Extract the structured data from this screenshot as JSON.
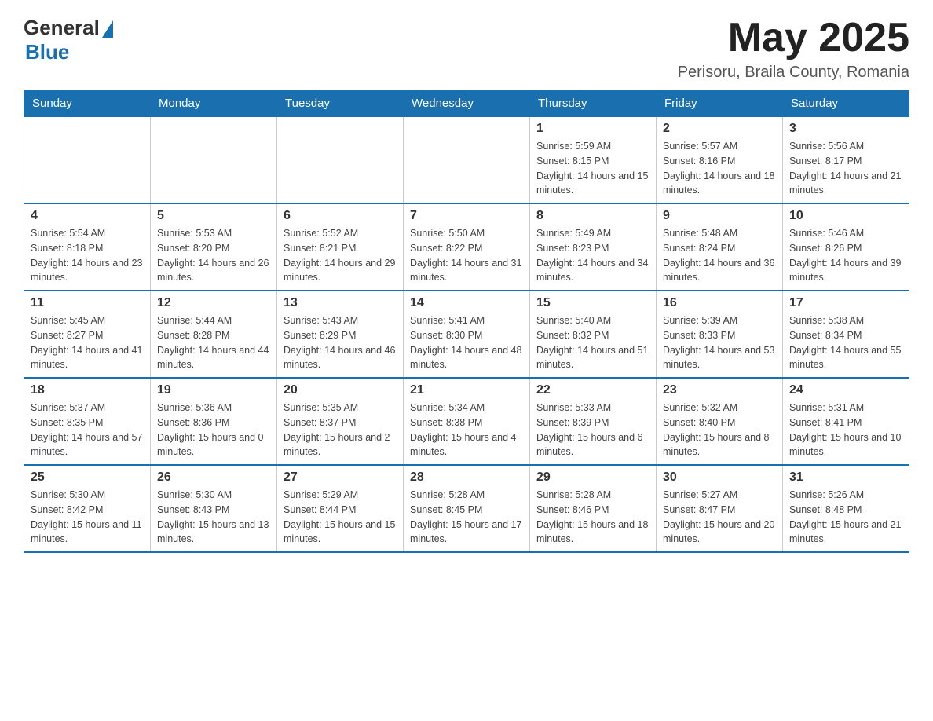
{
  "header": {
    "logo_general": "General",
    "logo_blue": "Blue",
    "month_year": "May 2025",
    "location": "Perisoru, Braila County, Romania"
  },
  "weekdays": [
    "Sunday",
    "Monday",
    "Tuesday",
    "Wednesday",
    "Thursday",
    "Friday",
    "Saturday"
  ],
  "weeks": [
    [
      {
        "day": "",
        "sunrise": "",
        "sunset": "",
        "daylight": ""
      },
      {
        "day": "",
        "sunrise": "",
        "sunset": "",
        "daylight": ""
      },
      {
        "day": "",
        "sunrise": "",
        "sunset": "",
        "daylight": ""
      },
      {
        "day": "",
        "sunrise": "",
        "sunset": "",
        "daylight": ""
      },
      {
        "day": "1",
        "sunrise": "Sunrise: 5:59 AM",
        "sunset": "Sunset: 8:15 PM",
        "daylight": "Daylight: 14 hours and 15 minutes."
      },
      {
        "day": "2",
        "sunrise": "Sunrise: 5:57 AM",
        "sunset": "Sunset: 8:16 PM",
        "daylight": "Daylight: 14 hours and 18 minutes."
      },
      {
        "day": "3",
        "sunrise": "Sunrise: 5:56 AM",
        "sunset": "Sunset: 8:17 PM",
        "daylight": "Daylight: 14 hours and 21 minutes."
      }
    ],
    [
      {
        "day": "4",
        "sunrise": "Sunrise: 5:54 AM",
        "sunset": "Sunset: 8:18 PM",
        "daylight": "Daylight: 14 hours and 23 minutes."
      },
      {
        "day": "5",
        "sunrise": "Sunrise: 5:53 AM",
        "sunset": "Sunset: 8:20 PM",
        "daylight": "Daylight: 14 hours and 26 minutes."
      },
      {
        "day": "6",
        "sunrise": "Sunrise: 5:52 AM",
        "sunset": "Sunset: 8:21 PM",
        "daylight": "Daylight: 14 hours and 29 minutes."
      },
      {
        "day": "7",
        "sunrise": "Sunrise: 5:50 AM",
        "sunset": "Sunset: 8:22 PM",
        "daylight": "Daylight: 14 hours and 31 minutes."
      },
      {
        "day": "8",
        "sunrise": "Sunrise: 5:49 AM",
        "sunset": "Sunset: 8:23 PM",
        "daylight": "Daylight: 14 hours and 34 minutes."
      },
      {
        "day": "9",
        "sunrise": "Sunrise: 5:48 AM",
        "sunset": "Sunset: 8:24 PM",
        "daylight": "Daylight: 14 hours and 36 minutes."
      },
      {
        "day": "10",
        "sunrise": "Sunrise: 5:46 AM",
        "sunset": "Sunset: 8:26 PM",
        "daylight": "Daylight: 14 hours and 39 minutes."
      }
    ],
    [
      {
        "day": "11",
        "sunrise": "Sunrise: 5:45 AM",
        "sunset": "Sunset: 8:27 PM",
        "daylight": "Daylight: 14 hours and 41 minutes."
      },
      {
        "day": "12",
        "sunrise": "Sunrise: 5:44 AM",
        "sunset": "Sunset: 8:28 PM",
        "daylight": "Daylight: 14 hours and 44 minutes."
      },
      {
        "day": "13",
        "sunrise": "Sunrise: 5:43 AM",
        "sunset": "Sunset: 8:29 PM",
        "daylight": "Daylight: 14 hours and 46 minutes."
      },
      {
        "day": "14",
        "sunrise": "Sunrise: 5:41 AM",
        "sunset": "Sunset: 8:30 PM",
        "daylight": "Daylight: 14 hours and 48 minutes."
      },
      {
        "day": "15",
        "sunrise": "Sunrise: 5:40 AM",
        "sunset": "Sunset: 8:32 PM",
        "daylight": "Daylight: 14 hours and 51 minutes."
      },
      {
        "day": "16",
        "sunrise": "Sunrise: 5:39 AM",
        "sunset": "Sunset: 8:33 PM",
        "daylight": "Daylight: 14 hours and 53 minutes."
      },
      {
        "day": "17",
        "sunrise": "Sunrise: 5:38 AM",
        "sunset": "Sunset: 8:34 PM",
        "daylight": "Daylight: 14 hours and 55 minutes."
      }
    ],
    [
      {
        "day": "18",
        "sunrise": "Sunrise: 5:37 AM",
        "sunset": "Sunset: 8:35 PM",
        "daylight": "Daylight: 14 hours and 57 minutes."
      },
      {
        "day": "19",
        "sunrise": "Sunrise: 5:36 AM",
        "sunset": "Sunset: 8:36 PM",
        "daylight": "Daylight: 15 hours and 0 minutes."
      },
      {
        "day": "20",
        "sunrise": "Sunrise: 5:35 AM",
        "sunset": "Sunset: 8:37 PM",
        "daylight": "Daylight: 15 hours and 2 minutes."
      },
      {
        "day": "21",
        "sunrise": "Sunrise: 5:34 AM",
        "sunset": "Sunset: 8:38 PM",
        "daylight": "Daylight: 15 hours and 4 minutes."
      },
      {
        "day": "22",
        "sunrise": "Sunrise: 5:33 AM",
        "sunset": "Sunset: 8:39 PM",
        "daylight": "Daylight: 15 hours and 6 minutes."
      },
      {
        "day": "23",
        "sunrise": "Sunrise: 5:32 AM",
        "sunset": "Sunset: 8:40 PM",
        "daylight": "Daylight: 15 hours and 8 minutes."
      },
      {
        "day": "24",
        "sunrise": "Sunrise: 5:31 AM",
        "sunset": "Sunset: 8:41 PM",
        "daylight": "Daylight: 15 hours and 10 minutes."
      }
    ],
    [
      {
        "day": "25",
        "sunrise": "Sunrise: 5:30 AM",
        "sunset": "Sunset: 8:42 PM",
        "daylight": "Daylight: 15 hours and 11 minutes."
      },
      {
        "day": "26",
        "sunrise": "Sunrise: 5:30 AM",
        "sunset": "Sunset: 8:43 PM",
        "daylight": "Daylight: 15 hours and 13 minutes."
      },
      {
        "day": "27",
        "sunrise": "Sunrise: 5:29 AM",
        "sunset": "Sunset: 8:44 PM",
        "daylight": "Daylight: 15 hours and 15 minutes."
      },
      {
        "day": "28",
        "sunrise": "Sunrise: 5:28 AM",
        "sunset": "Sunset: 8:45 PM",
        "daylight": "Daylight: 15 hours and 17 minutes."
      },
      {
        "day": "29",
        "sunrise": "Sunrise: 5:28 AM",
        "sunset": "Sunset: 8:46 PM",
        "daylight": "Daylight: 15 hours and 18 minutes."
      },
      {
        "day": "30",
        "sunrise": "Sunrise: 5:27 AM",
        "sunset": "Sunset: 8:47 PM",
        "daylight": "Daylight: 15 hours and 20 minutes."
      },
      {
        "day": "31",
        "sunrise": "Sunrise: 5:26 AM",
        "sunset": "Sunset: 8:48 PM",
        "daylight": "Daylight: 15 hours and 21 minutes."
      }
    ]
  ]
}
